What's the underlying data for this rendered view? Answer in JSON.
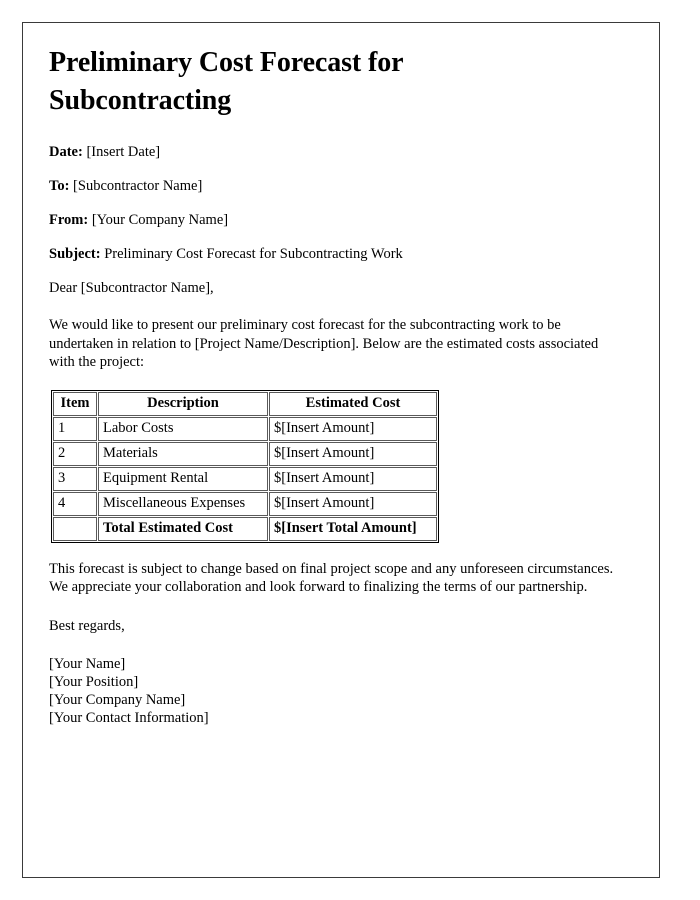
{
  "document": {
    "title": "Preliminary Cost Forecast for Subcontracting",
    "meta": [
      {
        "label": "Date:",
        "value": "[Insert Date]"
      },
      {
        "label": "To:",
        "value": "[Subcontractor Name]"
      },
      {
        "label": "From:",
        "value": "[Your Company Name]"
      },
      {
        "label": "Subject:",
        "value": "Preliminary Cost Forecast for Subcontracting Work"
      }
    ],
    "salutation": "Dear [Subcontractor Name],",
    "intro_paragraph": "We would like to present our preliminary cost forecast for the subcontracting work to be undertaken in relation to [Project Name/Description]. Below are the estimated costs associated with the project:",
    "table": {
      "headers": [
        "Item",
        "Description",
        "Estimated Cost"
      ],
      "rows": [
        {
          "item": "1",
          "description": "Labor Costs",
          "cost": "$[Insert Amount]"
        },
        {
          "item": "2",
          "description": "Materials",
          "cost": "$[Insert Amount]"
        },
        {
          "item": "3",
          "description": "Equipment Rental",
          "cost": "$[Insert Amount]"
        },
        {
          "item": "4",
          "description": "Miscellaneous Expenses",
          "cost": "$[Insert Amount]"
        }
      ],
      "total_row": {
        "item": "",
        "description": "Total Estimated Cost",
        "cost": "$[Insert Total Amount]"
      }
    },
    "closing_paragraph": "This forecast is subject to change based on final project scope and any unforeseen circumstances. We appreciate your collaboration and look forward to finalizing the terms of our partnership.",
    "sign_off": "Best regards,",
    "signature": [
      "[Your Name]",
      "[Your Position]",
      "[Your Company Name]",
      "[Your Contact Information]"
    ]
  }
}
